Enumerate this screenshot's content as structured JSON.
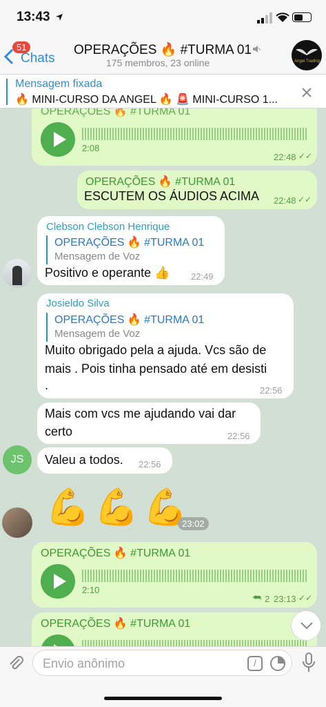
{
  "status": {
    "time": "13:43"
  },
  "header": {
    "back_badge": "51",
    "back_label": "Chats",
    "title": "OPERAÇÕES 🔥 #TURMA 01",
    "subtitle": "175 membros, 23 online",
    "avatar_text": "Angel Trading"
  },
  "pinned": {
    "label": "Mensagem fixada",
    "text": "🔥 MINI-CURSO DA ANGEL 🔥 🚨 MINI-CURSO 1..."
  },
  "messages": {
    "m1": {
      "partial_title": "OPERAÇÕES 🔥 #TURMA 01",
      "duration": "2:08",
      "time": "22:48"
    },
    "m2": {
      "title": "OPERAÇÕES 🔥 #TURMA 01",
      "text": "ESCUTEM OS ÁUDIOS ACIMA",
      "time": "22:48"
    },
    "m3": {
      "sender": "Clebson Clebson Henrique",
      "quote_title": "OPERAÇÕES 🔥 #TURMA 01",
      "quote_sub": "Mensagem de Voz",
      "text": "Positivo e operante 👍",
      "time": "22:49"
    },
    "m4": {
      "sender": "Josieldo Silva",
      "quote_title": "OPERAÇÕES 🔥 #TURMA 01",
      "quote_sub": "Mensagem de Voz",
      "line1": "Muito obrigado pela a ajuda. Vcs são de",
      "line2": "mais . Pois tinha pensado até em desisti",
      "line3": ".",
      "time": "22:56"
    },
    "m5": {
      "line1": "Mais com vcs me ajudando vai dar",
      "line2": "certo",
      "time": "22:56"
    },
    "m6": {
      "avatar": "JS",
      "text": "Valeu a todos.",
      "time": "22:56"
    },
    "m7": {
      "emoji": "💪💪💪",
      "time": "23:02"
    },
    "m8": {
      "title": "OPERAÇÕES 🔥 #TURMA 01",
      "duration": "2:10",
      "replies": "2",
      "time": "23:13"
    },
    "m9": {
      "title": "OPERAÇÕES 🔥 #TURMA 01"
    }
  },
  "input": {
    "placeholder": "Envio anônimo"
  },
  "colors": {
    "accent": "#2b8fdb",
    "bubble_out": "#e1f9c7",
    "chat_bg": "#d2dfd5"
  }
}
